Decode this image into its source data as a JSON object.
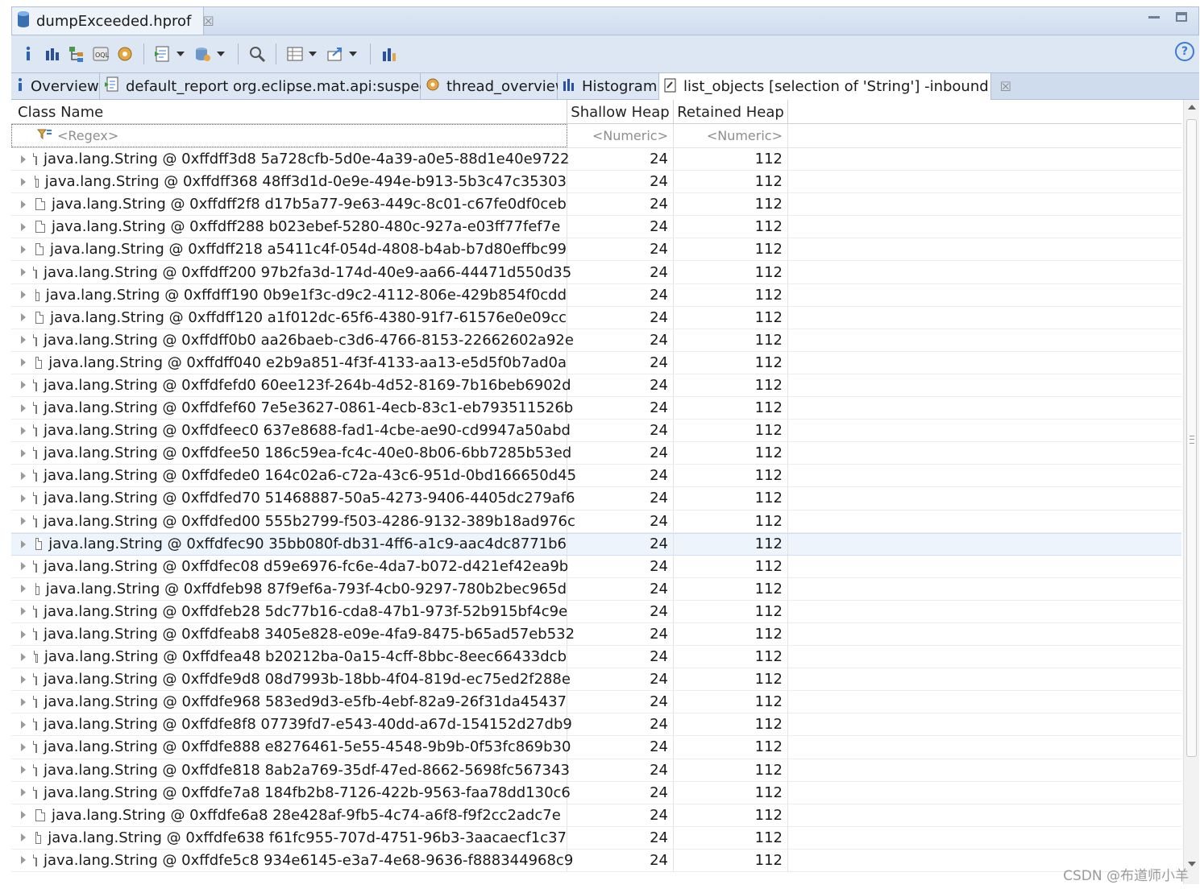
{
  "editor": {
    "tab_label": "dumpExceeded.hprof"
  },
  "subtabs": [
    {
      "label": "Overview"
    },
    {
      "label": "default_report  org.eclipse.mat.api:suspects"
    },
    {
      "label": "thread_overview"
    },
    {
      "label": "Histogram"
    },
    {
      "label": "list_objects  [selection of 'String'] -inbound"
    }
  ],
  "table": {
    "columns": [
      "Class Name",
      "Shallow Heap",
      "Retained Heap"
    ],
    "filters": [
      "<Regex>",
      "<Numeric>",
      "<Numeric>"
    ],
    "rows": [
      {
        "name": "java.lang.String @ 0xffdff3d8  5a728cfb-5d0e-4a39-a0e5-88d1e40e9722",
        "shallow": "24",
        "retained": "112"
      },
      {
        "name": "java.lang.String @ 0xffdff368  48ff3d1d-0e9e-494e-b913-5b3c47c35303",
        "shallow": "24",
        "retained": "112"
      },
      {
        "name": "java.lang.String @ 0xffdff2f8  d17b5a77-9e63-449c-8c01-c67fe0df0ceb",
        "shallow": "24",
        "retained": "112"
      },
      {
        "name": "java.lang.String @ 0xffdff288  b023ebef-5280-480c-927a-e03ff77fef7e",
        "shallow": "24",
        "retained": "112"
      },
      {
        "name": "java.lang.String @ 0xffdff218  a5411c4f-054d-4808-b4ab-b7d80effbc99",
        "shallow": "24",
        "retained": "112"
      },
      {
        "name": "java.lang.String @ 0xffdff200  97b2fa3d-174d-40e9-aa66-44471d550d35",
        "shallow": "24",
        "retained": "112"
      },
      {
        "name": "java.lang.String @ 0xffdff190  0b9e1f3c-d9c2-4112-806e-429b854f0cdd",
        "shallow": "24",
        "retained": "112"
      },
      {
        "name": "java.lang.String @ 0xffdff120  a1f012dc-65f6-4380-91f7-61576e0e09cc",
        "shallow": "24",
        "retained": "112"
      },
      {
        "name": "java.lang.String @ 0xffdff0b0  aa26baeb-c3d6-4766-8153-22662602a92e",
        "shallow": "24",
        "retained": "112"
      },
      {
        "name": "java.lang.String @ 0xffdff040  e2b9a851-4f3f-4133-aa13-e5d5f0b7ad0a",
        "shallow": "24",
        "retained": "112"
      },
      {
        "name": "java.lang.String @ 0xffdfefd0  60ee123f-264b-4d52-8169-7b16beb6902d",
        "shallow": "24",
        "retained": "112"
      },
      {
        "name": "java.lang.String @ 0xffdfef60  7e5e3627-0861-4ecb-83c1-eb793511526b",
        "shallow": "24",
        "retained": "112"
      },
      {
        "name": "java.lang.String @ 0xffdfeec0  637e8688-fad1-4cbe-ae90-cd9947a50abd",
        "shallow": "24",
        "retained": "112"
      },
      {
        "name": "java.lang.String @ 0xffdfee50  186c59ea-fc4c-40e0-8b06-6bb7285b53ed",
        "shallow": "24",
        "retained": "112"
      },
      {
        "name": "java.lang.String @ 0xffdfede0  164c02a6-c72a-43c6-951d-0bd166650d45",
        "shallow": "24",
        "retained": "112"
      },
      {
        "name": "java.lang.String @ 0xffdfed70  51468887-50a5-4273-9406-4405dc279af6",
        "shallow": "24",
        "retained": "112"
      },
      {
        "name": "java.lang.String @ 0xffdfed00  555b2799-f503-4286-9132-389b18ad976c",
        "shallow": "24",
        "retained": "112"
      },
      {
        "name": "java.lang.String @ 0xffdfec90  35bb080f-db31-4ff6-a1c9-aac4dc8771b6",
        "shallow": "24",
        "retained": "112",
        "selected": true
      },
      {
        "name": "java.lang.String @ 0xffdfec08  d59e6976-fc6e-4da7-b072-d421ef42ea9b",
        "shallow": "24",
        "retained": "112"
      },
      {
        "name": "java.lang.String @ 0xffdfeb98  87f9ef6a-793f-4cb0-9297-780b2bec965d",
        "shallow": "24",
        "retained": "112"
      },
      {
        "name": "java.lang.String @ 0xffdfeb28  5dc77b16-cda8-47b1-973f-52b915bf4c9e",
        "shallow": "24",
        "retained": "112"
      },
      {
        "name": "java.lang.String @ 0xffdfeab8  3405e828-e09e-4fa9-8475-b65ad57eb532",
        "shallow": "24",
        "retained": "112"
      },
      {
        "name": "java.lang.String @ 0xffdfea48  b20212ba-0a15-4cff-8bbc-8eec66433dcb",
        "shallow": "24",
        "retained": "112"
      },
      {
        "name": "java.lang.String @ 0xffdfe9d8  08d7993b-18bb-4f04-819d-ec75ed2f288e",
        "shallow": "24",
        "retained": "112"
      },
      {
        "name": "java.lang.String @ 0xffdfe968  583ed9d3-e5fb-4ebf-82a9-26f31da45437",
        "shallow": "24",
        "retained": "112"
      },
      {
        "name": "java.lang.String @ 0xffdfe8f8  07739fd7-e543-40dd-a67d-154152d27db9",
        "shallow": "24",
        "retained": "112"
      },
      {
        "name": "java.lang.String @ 0xffdfe888  e8276461-5e55-4548-9b9b-0f53fc869b30",
        "shallow": "24",
        "retained": "112"
      },
      {
        "name": "java.lang.String @ 0xffdfe818  8ab2a769-35df-47ed-8662-5698fc567343",
        "shallow": "24",
        "retained": "112"
      },
      {
        "name": "java.lang.String @ 0xffdfe7a8  184fb2b8-7126-422b-9563-faa78dd130c6",
        "shallow": "24",
        "retained": "112"
      },
      {
        "name": "java.lang.String @ 0xffdfe6a8  28e428af-9fb5-4c74-a6f8-f9f2cc2adc7e",
        "shallow": "24",
        "retained": "112"
      },
      {
        "name": "java.lang.String @ 0xffdfe638  f61fc955-707d-4751-96b3-3aacaecf1c37",
        "shallow": "24",
        "retained": "112"
      },
      {
        "name": "java.lang.String @ 0xffdfe5c8  934e6145-e3a7-4e68-9636-f888344968c9",
        "shallow": "24",
        "retained": "112"
      }
    ]
  },
  "watermark": "CSDN @布道师小羊",
  "colors": {
    "accent": "#3a7bd5",
    "toolbar_bg": "#dde7f4",
    "tab_bg": "#cfdcee"
  },
  "icons": [
    "info-icon",
    "histogram-icon",
    "dominator-tree-icon",
    "oql-icon",
    "thread-icon",
    "run-report-icon",
    "query-browser-icon",
    "search-icon",
    "group-by-icon",
    "export-icon",
    "calculate-retained-icon",
    "help-icon"
  ]
}
